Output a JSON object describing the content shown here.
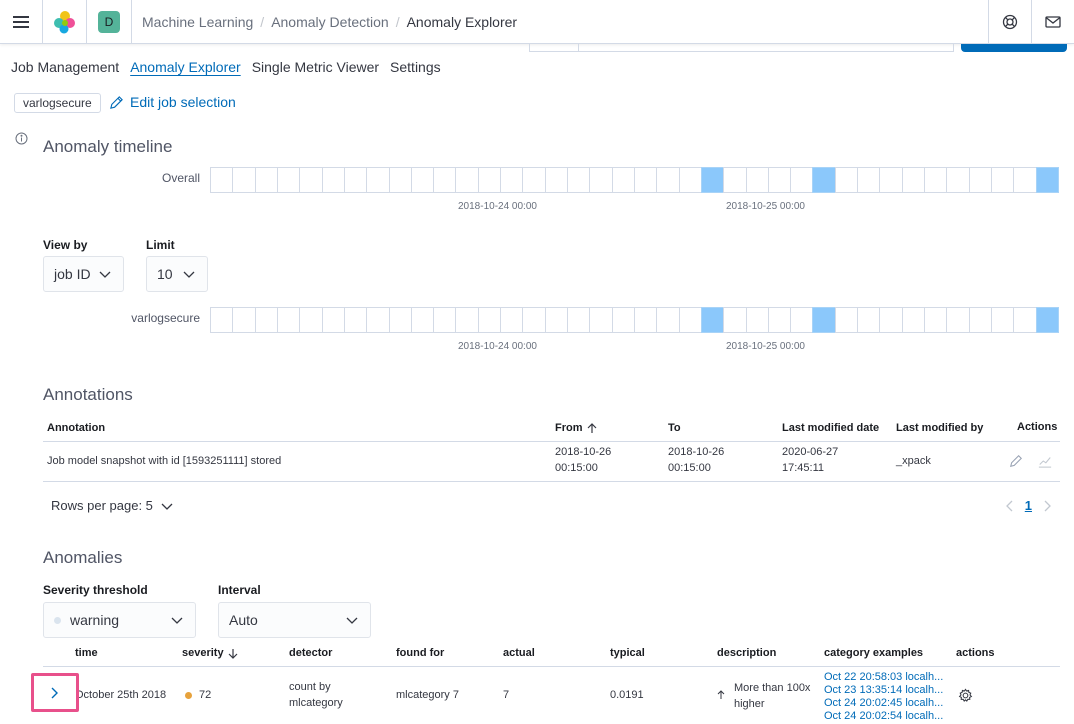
{
  "header": {
    "space_initial": "D",
    "breadcrumbs": [
      "Machine Learning",
      "Anomaly Detection",
      "Anomaly Explorer"
    ],
    "breadcrumb_separator": "/"
  },
  "tabs": [
    "Job Management",
    "Anomaly Explorer",
    "Single Metric Viewer",
    "Settings"
  ],
  "job_selection": {
    "badge": "varlogsecure",
    "edit_label": "Edit job selection"
  },
  "timeline": {
    "title": "Anomaly timeline",
    "overall_label": "Overall",
    "job_label": "varlogsecure",
    "axis_labels": [
      "2018-10-24 00:00",
      "2018-10-25 00:00"
    ],
    "cell_count": 38,
    "hit_cells": [
      22,
      27,
      37
    ]
  },
  "controls": {
    "view_by_label": "View by",
    "view_by_value": "job ID",
    "limit_label": "Limit",
    "limit_value": "10"
  },
  "annotations": {
    "title": "Annotations",
    "columns": [
      "Annotation",
      "From",
      "To",
      "Last modified date",
      "Last modified by",
      "Actions"
    ],
    "rows": [
      {
        "annotation": "Job model snapshot with id [1593251111] stored",
        "from_date": "2018-10-26",
        "from_time": "00:15:00",
        "to_date": "2018-10-26",
        "to_time": "00:15:00",
        "modified_date": "2020-06-27",
        "modified_time": "17:45:11",
        "modified_by": "_xpack"
      }
    ],
    "rows_per_page": "Rows per page: 5",
    "page": "1"
  },
  "anomalies": {
    "title": "Anomalies",
    "severity_label": "Severity threshold",
    "severity_value": "warning",
    "interval_label": "Interval",
    "interval_value": "Auto",
    "columns": [
      "time",
      "severity",
      "detector",
      "found for",
      "actual",
      "typical",
      "description",
      "category examples",
      "actions"
    ],
    "rows": [
      {
        "time": "October 25th 2018",
        "severity": "72",
        "detector_line1": "count by",
        "detector_line2": "mlcategory",
        "found_for": "mlcategory 7",
        "actual": "7",
        "typical": "0.0191",
        "description_line1": "More than 100x",
        "description_line2": "higher",
        "examples": [
          "Oct 22 20:58:03 localh...",
          "Oct 23 13:35:14 localh...",
          "Oct 24 20:02:45 localh...",
          "Oct 24 20:02:54 localh..."
        ]
      }
    ]
  },
  "colors": {
    "accent": "#006bb8",
    "swim_hit": "#8bc8fb",
    "severity_warning": "#e7a23c",
    "highlight": "#e8508b"
  }
}
